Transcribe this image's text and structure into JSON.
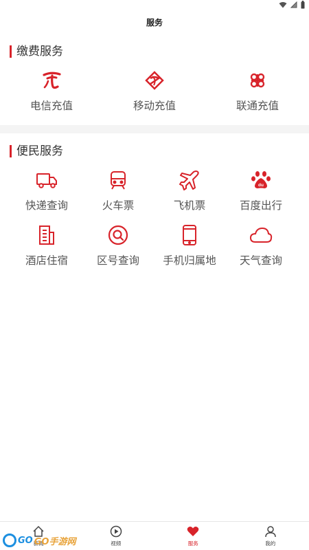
{
  "header": {
    "title": "服务"
  },
  "pay_section": {
    "title": "缴费服务",
    "items": [
      {
        "label": "电信充值",
        "icon": "china-telecom-icon"
      },
      {
        "label": "移动充值",
        "icon": "china-mobile-icon"
      },
      {
        "label": "联通充值",
        "icon": "china-unicom-icon"
      }
    ]
  },
  "life_section": {
    "title": "便民服务",
    "items": [
      {
        "label": "快递查询",
        "icon": "truck-icon"
      },
      {
        "label": "火车票",
        "icon": "train-icon"
      },
      {
        "label": "飞机票",
        "icon": "airplane-icon"
      },
      {
        "label": "百度出行",
        "icon": "baidu-icon"
      },
      {
        "label": "酒店住宿",
        "icon": "building-icon"
      },
      {
        "label": "区号查询",
        "icon": "search-icon"
      },
      {
        "label": "手机归属地",
        "icon": "phone-icon"
      },
      {
        "label": "天气查询",
        "icon": "cloud-icon"
      }
    ]
  },
  "tabbar": {
    "tabs": [
      {
        "label": "新闻",
        "icon": "home-icon",
        "active": false
      },
      {
        "label": "视频",
        "icon": "play-icon",
        "active": false
      },
      {
        "label": "服务",
        "icon": "heart-icon",
        "active": true
      },
      {
        "label": "我的",
        "icon": "user-icon",
        "active": false
      }
    ]
  },
  "watermark": {
    "brand": "GO",
    "brand2": "GO手游网"
  },
  "colors": {
    "accent": "#d8232a",
    "divider": "#f4f4f4",
    "text": "#555555"
  }
}
